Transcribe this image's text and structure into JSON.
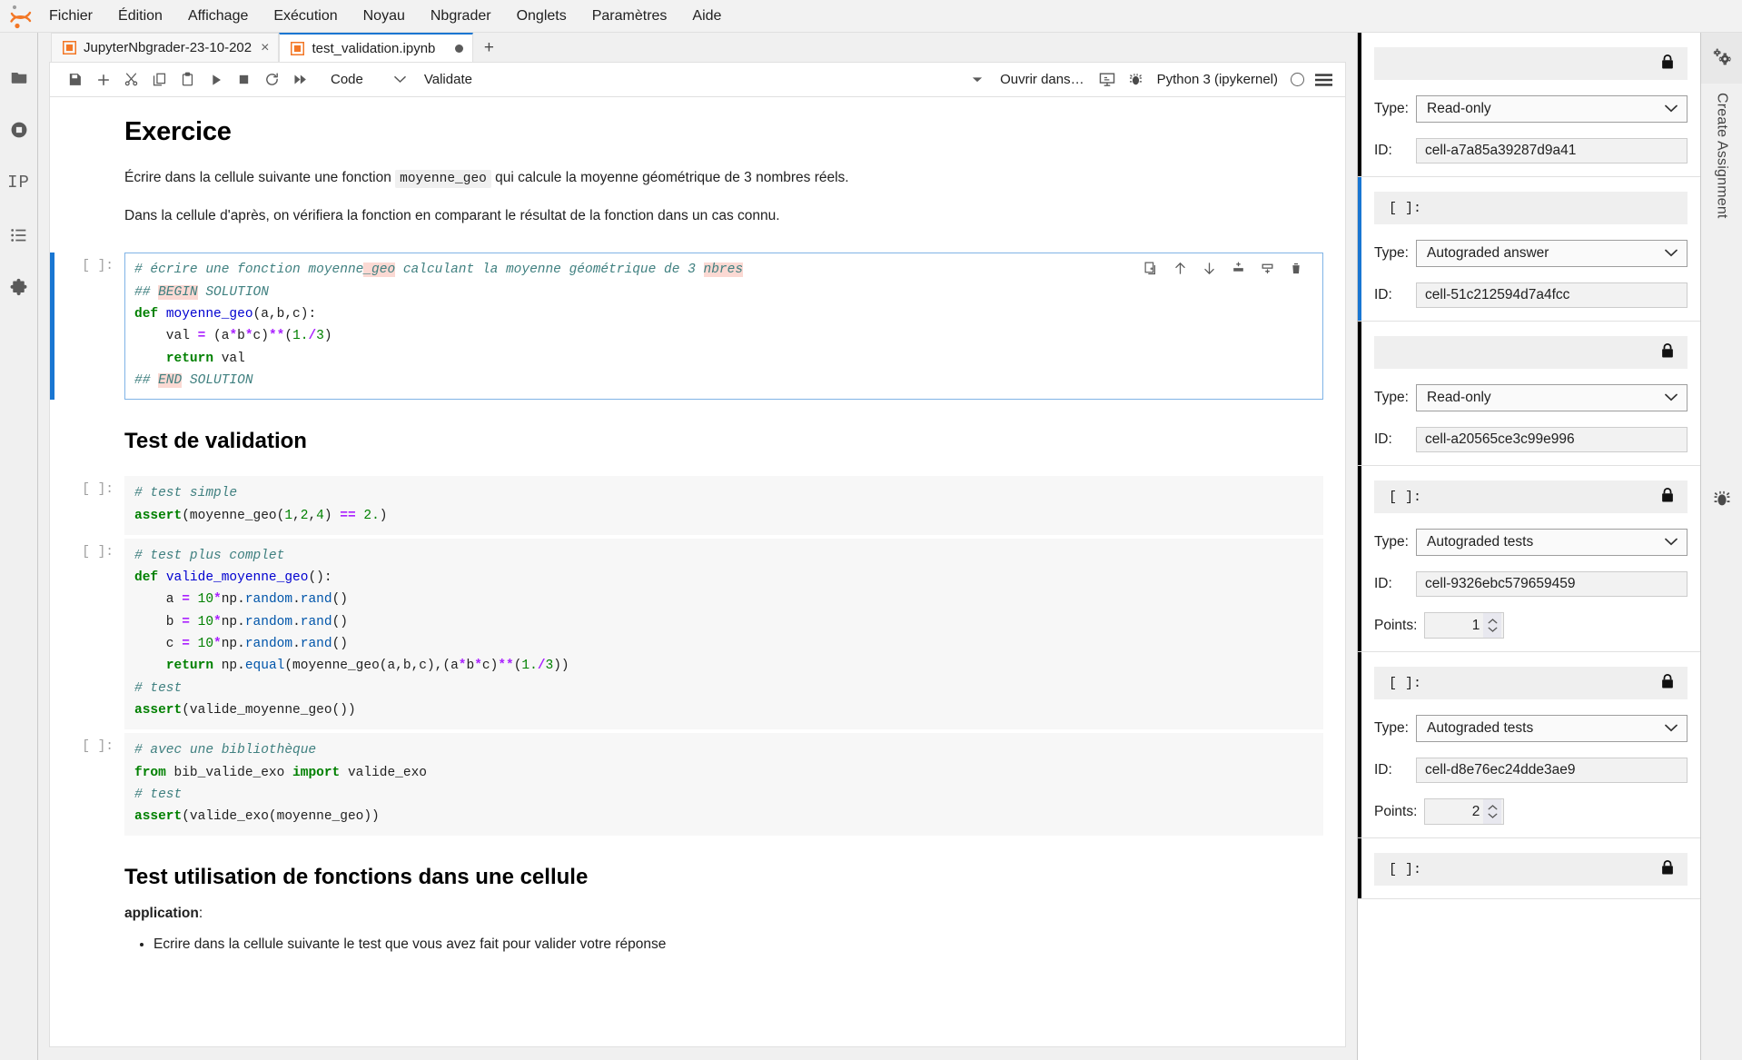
{
  "menubar": {
    "logo_icon": "jupyter-logo-icon",
    "items": [
      {
        "label": "Fichier"
      },
      {
        "label": "Édition"
      },
      {
        "label": "Affichage"
      },
      {
        "label": "Exécution"
      },
      {
        "label": "Noyau"
      },
      {
        "label": "Nbgrader"
      },
      {
        "label": "Onglets"
      },
      {
        "label": "Paramètres"
      },
      {
        "label": "Aide"
      }
    ]
  },
  "left_sidebar": {
    "items": [
      {
        "name": "file-browser",
        "icon": "folder-icon"
      },
      {
        "name": "running-terminals-kernels",
        "icon": "stop-circle-icon"
      },
      {
        "name": "ipython-commands",
        "icon": "IP"
      },
      {
        "name": "table-of-contents",
        "icon": "list-icon"
      },
      {
        "name": "extension-manager",
        "icon": "puzzle-icon"
      }
    ]
  },
  "tabs": [
    {
      "label": "JupyterNbgrader-23-10-202",
      "icon": "notebook-icon",
      "active": false,
      "close": "×"
    },
    {
      "label": "test_validation.ipynb",
      "icon": "notebook-icon",
      "active": true,
      "dirty": true
    }
  ],
  "tab_add_label": "+",
  "toolbar": {
    "buttons": [
      {
        "name": "save-button",
        "icon": "save-icon"
      },
      {
        "name": "insert-cell-button",
        "icon": "plus-icon"
      },
      {
        "name": "cut-button",
        "icon": "scissors-icon"
      },
      {
        "name": "copy-button",
        "icon": "copy-icon"
      },
      {
        "name": "paste-button",
        "icon": "clipboard-icon"
      },
      {
        "name": "run-button",
        "icon": "play-icon"
      },
      {
        "name": "interrupt-button",
        "icon": "stop-icon"
      },
      {
        "name": "restart-button",
        "icon": "restart-icon"
      },
      {
        "name": "restart-run-all-button",
        "icon": "fast-forward-icon"
      }
    ],
    "cell_type": "Code",
    "validate_label": "Validate",
    "open_in_label": "Ouvrir dans…",
    "kernel_name": "Python 3 (ipykernel)"
  },
  "notebook": {
    "cells": [
      {
        "type": "markdown",
        "prompt": "",
        "heading1": "Exercice",
        "paragraphs": [
          {
            "pre": "Écrire dans la cellule suivante une fonction ",
            "code": "moyenne_geo",
            "post": " qui calcule la moyenne géométrique de 3 nombres réels."
          },
          {
            "pre": "Dans la cellule d'après, on vérifiera la fonction en comparant le résultat de la fonction dans un cas connu.",
            "code": "",
            "post": ""
          }
        ]
      },
      {
        "type": "code",
        "prompt": "[ ]:",
        "selected": true,
        "source": "# écrire une fonction moyenne_geo calculant la moyenne géométrique de 3 nbres\n## BEGIN SOLUTION\ndef moyenne_geo(a,b,c):\n    val = (a*b*c)**(1./3)\n    return val\n## END SOLUTION",
        "cell_toolbar": [
          {
            "name": "duplicate-cell-button",
            "icon": "duplicate-icon"
          },
          {
            "name": "move-cell-up-button",
            "icon": "arrow-up-icon"
          },
          {
            "name": "move-cell-down-button",
            "icon": "arrow-down-icon"
          },
          {
            "name": "insert-cell-above-button",
            "icon": "insert-above-icon"
          },
          {
            "name": "insert-cell-below-button",
            "icon": "insert-below-icon"
          },
          {
            "name": "delete-cell-button",
            "icon": "trash-icon"
          }
        ]
      },
      {
        "type": "markdown",
        "prompt": "",
        "heading2": "Test de validation"
      },
      {
        "type": "code",
        "prompt": "[ ]:",
        "source": "# test simple\nassert(moyenne_geo(1,2,4) == 2.)"
      },
      {
        "type": "code",
        "prompt": "[ ]:",
        "source": "# test plus complet\ndef valide_moyenne_geo():\n    a = 10*np.random.rand()\n    b = 10*np.random.rand()\n    c = 10*np.random.rand()\n    return np.equal(moyenne_geo(a,b,c),(a*b*c)**(1./3))\n# test\nassert(valide_moyenne_geo())"
      },
      {
        "type": "code",
        "prompt": "[ ]:",
        "source": "# avec une bibliothèque\nfrom bib_valide_exo import valide_exo\n# test\nassert(valide_exo(moyenne_geo))"
      },
      {
        "type": "markdown",
        "prompt": "",
        "heading2b": "Test utilisation de fonctions dans une cellule",
        "bold_label": "application",
        "bold_suffix": ":",
        "bullets": [
          "Ecrire dans la cellule suivante le test que vous avez fait pour valider votre réponse"
        ]
      }
    ]
  },
  "nbgrader_panel": {
    "type_label": "Type:",
    "id_label": "ID:",
    "points_label": "Points:",
    "prompt_placeholder": "[ ]:",
    "blocks": [
      {
        "prompt": "",
        "locked": true,
        "accent": "black",
        "type": "Read-only",
        "id": "cell-a7a85a39287d9a41",
        "points": null
      },
      {
        "prompt": "[ ]:",
        "locked": false,
        "accent": "blue",
        "type": "Autograded answer",
        "id": "cell-51c212594d7a4fcc",
        "points": null
      },
      {
        "prompt": "",
        "locked": true,
        "accent": "black",
        "type": "Read-only",
        "id": "cell-a20565ce3c99e996",
        "points": null
      },
      {
        "prompt": "[ ]:",
        "locked": true,
        "accent": "black",
        "type": "Autograded tests",
        "id": "cell-9326ebc579659459",
        "points": "1"
      },
      {
        "prompt": "[ ]:",
        "locked": true,
        "accent": "black",
        "type": "Autograded tests",
        "id": "cell-d8e76ec24dde3ae9",
        "points": "2"
      },
      {
        "prompt": "[ ]:",
        "locked": true,
        "accent": "black",
        "type": "",
        "id": "",
        "points": null
      }
    ]
  },
  "right_sidebar": {
    "create_assignment_label": "Create Assignment",
    "gear_icon": "gears-icon",
    "debugger_icon": "bug-icon"
  },
  "colors": {
    "accent_blue": "#1976d2",
    "jupyter_orange": "#f37726",
    "comment_teal": "#408080",
    "keyword_green": "#008000",
    "error_pink": "#fbd9d3"
  }
}
